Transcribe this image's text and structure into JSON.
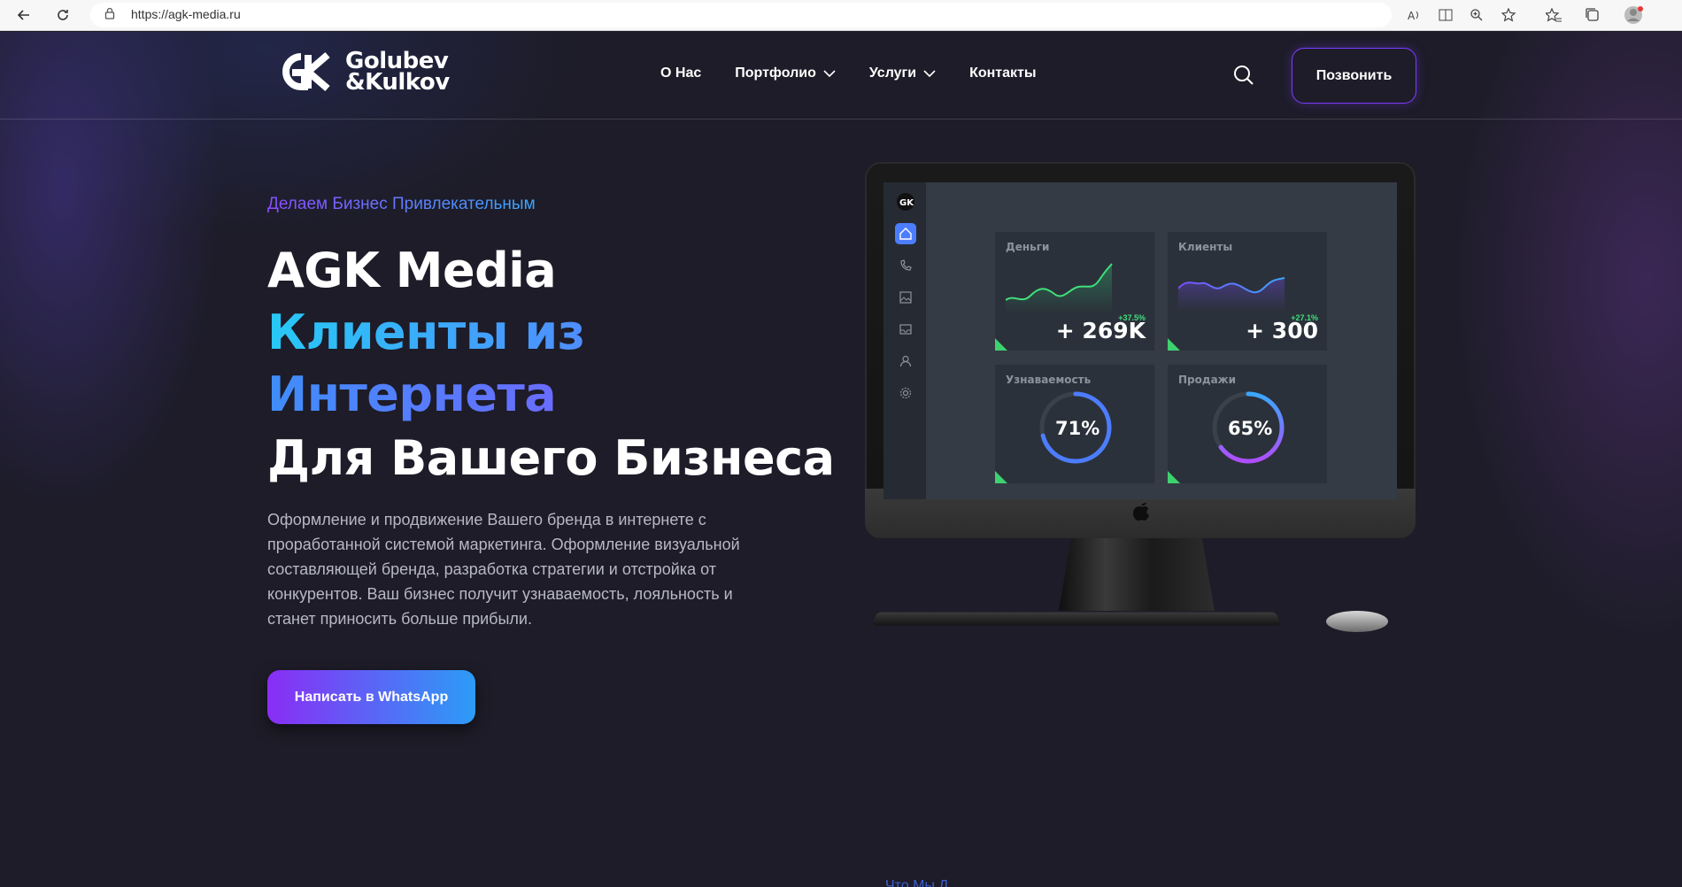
{
  "browser": {
    "url": "https://agk-media.ru"
  },
  "header": {
    "logo_line1": "Golubev",
    "logo_line2": "&Kulkov",
    "nav": [
      {
        "label": "О Нас"
      },
      {
        "label": "Портфолио"
      },
      {
        "label": "Услуги"
      },
      {
        "label": "Контакты"
      }
    ],
    "call_label": "Позвонить"
  },
  "hero": {
    "tagline": "Делаем Бизнес Привлекательным",
    "title_line1": "AGK Media",
    "title_line2": "Клиенты из",
    "title_line3": "Интернета",
    "title_line4": "Для Вашего Бизнеса",
    "description": "Оформление и продвижение Вашего бренда в интернете с проработанной системой маркетинга. Оформление визуальной составляющей бренда, разработка стратегии и отстройка от конкурентов. Ваш бизнес получит узнаваемость, лояльность и станет приносить больше прибыли.",
    "whatsapp_label": "Написать в WhatsApp"
  },
  "dashboard": {
    "cards": [
      {
        "title": "Деньги",
        "value": "+ 269K",
        "change": "+37.5%"
      },
      {
        "title": "Клиенты",
        "value": "+ 300",
        "change": "+27.1%"
      },
      {
        "title": "Узнаваемость",
        "value": "71%",
        "level": 0.71
      },
      {
        "title": "Продажи",
        "value": "65%",
        "level": 0.65
      }
    ]
  },
  "teaser": "Что Мы Д..."
}
